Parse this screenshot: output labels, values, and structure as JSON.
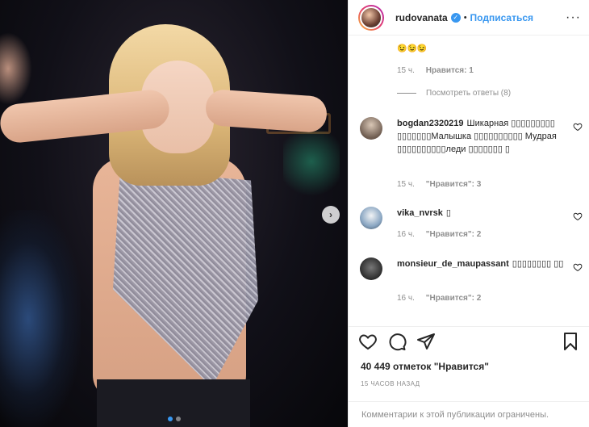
{
  "post": {
    "username": "rudovanata",
    "verified_icon": "verified-badge-icon",
    "follow_label": "Подписаться",
    "separator": "•",
    "more_label": "···",
    "carousel": {
      "total": 2,
      "active_index": 0,
      "next_icon": "chevron-right-icon"
    }
  },
  "comments": {
    "top_reply": {
      "emoji": "😉😉😉",
      "time": "15 ч.",
      "likes": "Нравится: 1",
      "view_replies": "Посмотреть ответы (8)"
    },
    "items": [
      {
        "username": "bogdan2320219",
        "text": "Шикарная ▯▯▯▯▯▯▯▯▯ ▯▯▯▯▯▯▯Малышка ▯▯▯▯▯▯▯▯▯▯ Мудрая ▯▯▯▯▯▯▯▯▯▯леди ▯▯▯▯▯▯▯ ▯",
        "time": "15 ч.",
        "likes": "\"Нравится\": 3"
      },
      {
        "username": "vika_nvrsk",
        "text": "▯",
        "time": "16 ч.",
        "likes": "\"Нравится\": 2"
      },
      {
        "username": "monsieur_de_maupassant",
        "text": "▯▯▯▯▯▯▯▯ ▯▯",
        "time": "16 ч.",
        "likes": "\"Нравится\": 2"
      }
    ]
  },
  "footer": {
    "likes_text": "40 449 отметок \"Нравится\"",
    "time_ago": "15 ЧАСОВ НАЗАД",
    "comments_limited": "Комментарии к этой публикации ограничены."
  },
  "colors": {
    "accent": "#3897f0",
    "text": "#262626",
    "muted": "#8e8e8e",
    "border": "#efefef"
  }
}
